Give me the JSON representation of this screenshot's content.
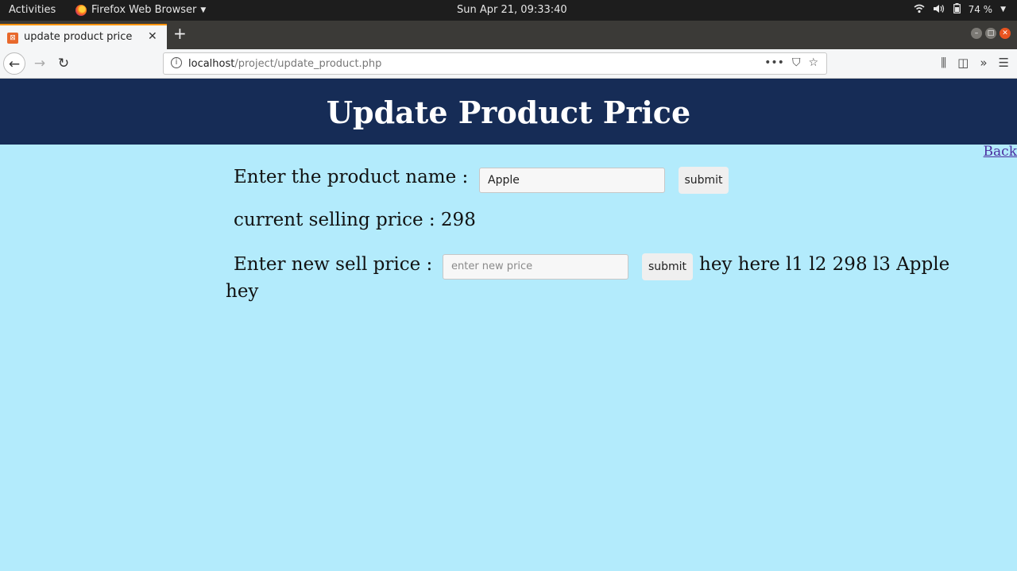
{
  "os_bar": {
    "activities": "Activities",
    "app_name": "Firefox Web Browser",
    "clock": "Sun Apr 21, 09:33:40",
    "battery": "74 %"
  },
  "browser": {
    "tab_title": "update product price",
    "url_host": "localhost",
    "url_path": "/project/update_product.php"
  },
  "page": {
    "heading": "Update Product Price",
    "back_link": "Back",
    "product_name_label": "Enter the product name :",
    "product_name_value": "Apple",
    "submit_label": "submit",
    "current_price_text": "current selling price : 298",
    "new_price_label": "Enter new sell price :",
    "new_price_placeholder": "enter new price",
    "submit2_label": "submit",
    "debug_text_line1": "hey here l1 l2 298 l3 Apple",
    "debug_text_line2": "hey"
  },
  "colors": {
    "header_bg": "#162c56",
    "page_bg": "#b3ebfc"
  }
}
